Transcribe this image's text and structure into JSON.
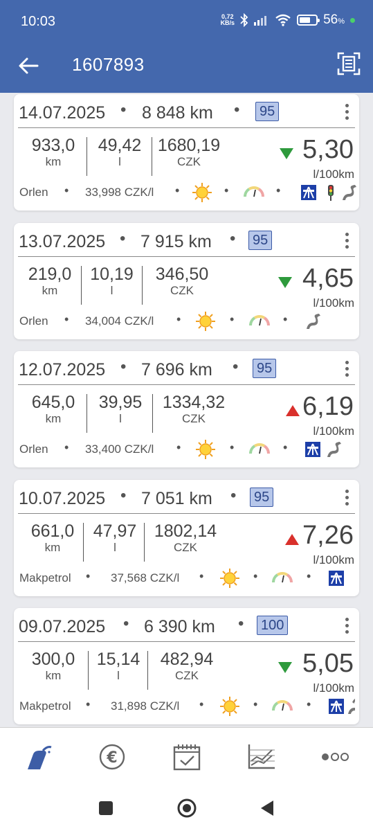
{
  "status": {
    "time": "10:03",
    "speed_value": "0,72",
    "speed_unit": "KB/s",
    "battery": "56",
    "battery_unit": "%"
  },
  "appbar": {
    "title": "1607893"
  },
  "colors": {
    "primary": "#4468ad",
    "down": "#2e9a3c",
    "up": "#d9302c",
    "badge": "#b7c7ea"
  },
  "entries": [
    {
      "date": "14.07.2025",
      "odometer": "8 848 km",
      "fuel": "95",
      "distance": "933,0",
      "distance_unit": "km",
      "volume": "49,42",
      "volume_unit": "l",
      "cost": "1680,19",
      "currency": "CZK",
      "trend": "down",
      "consumption": "5,30",
      "consumption_unit": "l/100km",
      "station": "Orlen",
      "price": "33,998 CZK/l",
      "icons": [
        "sun-icon",
        "gauge-icon",
        "highway-icon",
        "traffic-light-icon",
        "winding-road-icon"
      ]
    },
    {
      "date": "13.07.2025",
      "odometer": "7 915 km",
      "fuel": "95",
      "distance": "219,0",
      "distance_unit": "km",
      "volume": "10,19",
      "volume_unit": "l",
      "cost": "346,50",
      "currency": "CZK",
      "trend": "down",
      "consumption": "4,65",
      "consumption_unit": "l/100km",
      "station": "Orlen",
      "price": "34,004 CZK/l",
      "icons": [
        "sun-icon",
        "gauge-icon",
        "winding-road-icon"
      ]
    },
    {
      "date": "12.07.2025",
      "odometer": "7 696 km",
      "fuel": "95",
      "distance": "645,0",
      "distance_unit": "km",
      "volume": "39,95",
      "volume_unit": "l",
      "cost": "1334,32",
      "currency": "CZK",
      "trend": "up",
      "consumption": "6,19",
      "consumption_unit": "l/100km",
      "station": "Orlen",
      "price": "33,400 CZK/l",
      "icons": [
        "sun-icon",
        "gauge-icon",
        "highway-icon",
        "winding-road-icon"
      ]
    },
    {
      "date": "10.07.2025",
      "odometer": "7 051 km",
      "fuel": "95",
      "distance": "661,0",
      "distance_unit": "km",
      "volume": "47,97",
      "volume_unit": "l",
      "cost": "1802,14",
      "currency": "CZK",
      "trend": "up",
      "consumption": "7,26",
      "consumption_unit": "l/100km",
      "station": "Makpetrol",
      "price": "37,568 CZK/l",
      "icons": [
        "sun-icon",
        "gauge-icon",
        "highway-icon"
      ]
    },
    {
      "date": "09.07.2025",
      "odometer": "6 390 km",
      "fuel": "100",
      "distance": "300,0",
      "distance_unit": "km",
      "volume": "15,14",
      "volume_unit": "l",
      "cost": "482,94",
      "currency": "CZK",
      "trend": "down",
      "consumption": "5,05",
      "consumption_unit": "l/100km",
      "station": "Makpetrol",
      "price": "31,898 CZK/l",
      "icons": [
        "sun-icon",
        "gauge-icon",
        "highway-icon",
        "winding-road-icon"
      ]
    }
  ],
  "nav": [
    "fuel-pump-icon",
    "euro-icon",
    "calendar-icon",
    "chart-icon",
    "more-icon"
  ]
}
